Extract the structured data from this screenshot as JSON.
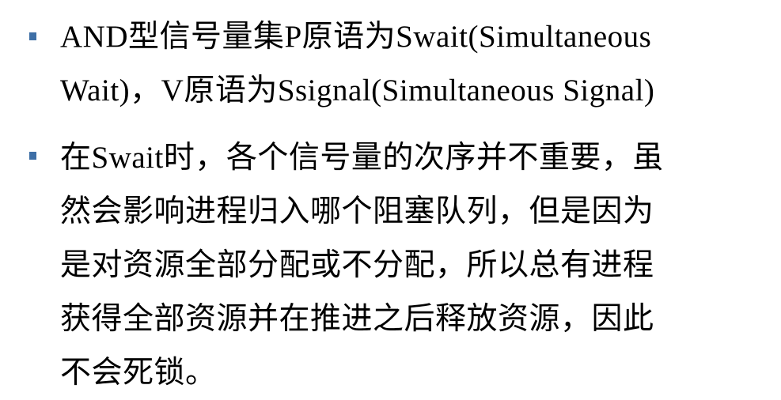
{
  "bullets": [
    {
      "lines": [
        "AND型信号量集P原语为Swait(Simultaneous",
        "Wait)，V原语为Ssignal(Simultaneous Signal)"
      ]
    },
    {
      "lines": [
        "在Swait时，各个信号量的次序并不重要，虽",
        "然会影响进程归入哪个阻塞队列，但是因为",
        "是对资源全部分配或不分配，所以总有进程",
        "获得全部资源并在推进之后释放资源，因此",
        "不会死锁。"
      ]
    }
  ],
  "colors": {
    "bullet": "#3e6fa6",
    "text": "#000000",
    "background": "#ffffff"
  }
}
